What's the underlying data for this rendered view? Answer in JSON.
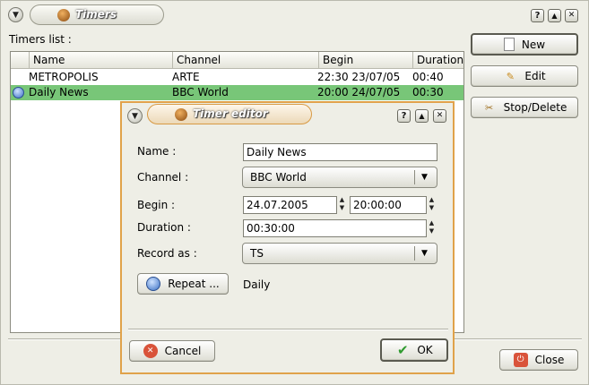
{
  "window": {
    "title": "Timers",
    "controls": {
      "help": "?",
      "shade": "▲",
      "close": "✕"
    }
  },
  "timers": {
    "list_label": "Timers list :",
    "columns": [
      "Name",
      "Channel",
      "Begin",
      "Duration"
    ],
    "rows": [
      {
        "name": "METROPOLIS",
        "channel": "ARTE",
        "begin": "22:30 23/07/05",
        "duration": "00:40",
        "selected": false
      },
      {
        "name": "Daily News",
        "channel": "BBC World",
        "begin": "20:00 24/07/05",
        "duration": "00:30",
        "selected": true
      }
    ],
    "buttons": {
      "new": "New",
      "edit": "Edit",
      "stop_delete": "Stop/Delete",
      "close": "Close"
    }
  },
  "editor": {
    "title": "Timer editor",
    "name_label": "Name :",
    "name_value": "Daily News",
    "channel_label": "Channel :",
    "channel_value": "BBC World",
    "begin_label": "Begin :",
    "begin_date": "24.07.2005",
    "begin_time": "20:00:00",
    "duration_label": "Duration :",
    "duration_value": "00:30:00",
    "record_label": "Record as :",
    "record_value": "TS",
    "repeat_button": "Repeat ...",
    "repeat_value": "Daily",
    "cancel": "Cancel",
    "ok": "OK"
  },
  "colors": {
    "selection": "#78c678",
    "dialog_border": "#e0a24a",
    "window_bg": "#eeeee6"
  },
  "icons": [
    "menu-icon",
    "app-ball-icon",
    "help-icon",
    "shade-icon",
    "close-icon",
    "new-document-icon",
    "edit-icon",
    "stop-delete-icon",
    "power-icon",
    "repeat-icon",
    "cancel-icon",
    "ok-check-icon",
    "dropdown-arrow-icon"
  ]
}
